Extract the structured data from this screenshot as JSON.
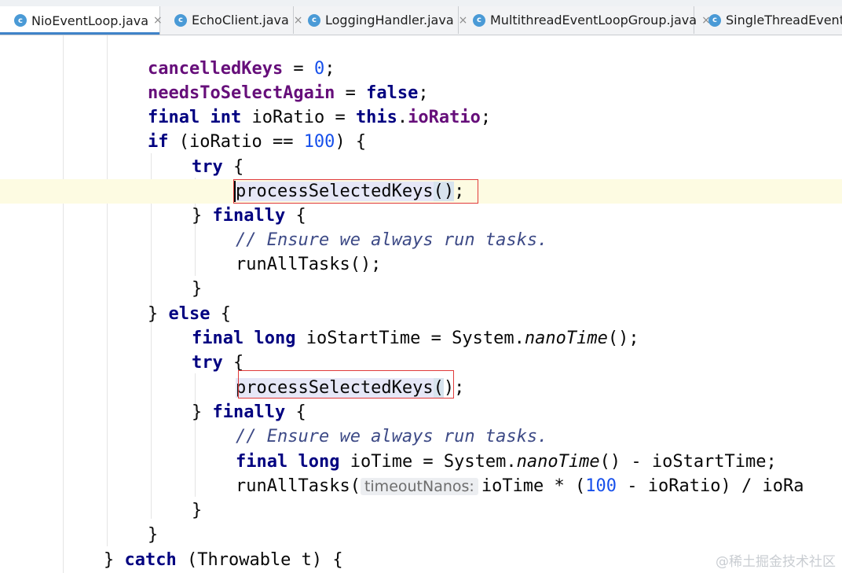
{
  "tabs": [
    {
      "label": "NioEventLoop.java",
      "icon": "java-class-icon",
      "close": "×",
      "active": true
    },
    {
      "label": "EchoClient.java",
      "icon": "java-class-icon",
      "close": "×",
      "active": false
    },
    {
      "label": "LoggingHandler.java",
      "icon": "java-class-icon",
      "close": "×",
      "active": false
    },
    {
      "label": "MultithreadEventLoopGroup.java",
      "icon": "java-class-icon",
      "close": "×",
      "active": false
    },
    {
      "label": "SingleThreadEventLo",
      "icon": "java-class-icon",
      "close": "",
      "active": false
    }
  ],
  "class_icon_glyph": "c",
  "code": {
    "l1": {
      "field": "cancelledKeys",
      "op": " = ",
      "num": "0",
      "end": ";"
    },
    "l2": {
      "field": "needsToSelectAgain",
      "op": " = ",
      "kw": "false",
      "end": ";"
    },
    "l3": {
      "kw1": "final",
      "kw2": "int",
      "mid": " ioRatio = ",
      "kw3": "this",
      "dot": ".",
      "field": "ioRatio",
      "end": ";"
    },
    "l4": {
      "kw": "if",
      "pre": " (ioRatio == ",
      "num": "100",
      "post": ") {"
    },
    "l5": {
      "kw": "try",
      "post": " {"
    },
    "l6": {
      "call": "processSelectedKeys",
      "open": "(",
      "close": ")",
      "end": ";"
    },
    "l7": {
      "pre": "} ",
      "kw": "finally",
      "post": " {"
    },
    "l8": {
      "comment": "// Ensure we always run tasks."
    },
    "l9": {
      "text": "runAllTasks();"
    },
    "l10": {
      "text": "}"
    },
    "l11": {
      "pre": "} ",
      "kw": "else",
      "post": " {"
    },
    "l12": {
      "kw1": "final",
      "kw2": "long",
      "mid": " ioStartTime = System.",
      "method": "nanoTime",
      "end": "();"
    },
    "l13": {
      "kw": "try",
      "post": " {"
    },
    "l14": {
      "call": "processSelectedKeys",
      "open": "(",
      "close": ")",
      "end": ";"
    },
    "l15": {
      "pre": "} ",
      "kw": "finally",
      "post": " {"
    },
    "l16": {
      "comment": "// Ensure we always run tasks."
    },
    "l17": {
      "kw1": "final",
      "kw2": "long",
      "mid": " ioTime = System.",
      "method": "nanoTime",
      "end": "() - ioStartTime;"
    },
    "l18": {
      "pre": "runAllTasks(",
      "hint": "timeoutNanos:",
      "mid": "ioTime * (",
      "num": "100",
      "post": " - ioRatio) / ioRa"
    },
    "l19": {
      "text": "}"
    },
    "l20": {
      "text": "}"
    },
    "l21": {
      "pre": "} ",
      "kw": "catch",
      "post": " (Throwable t) {"
    }
  },
  "watermark": "@稀土掘金技术社区"
}
